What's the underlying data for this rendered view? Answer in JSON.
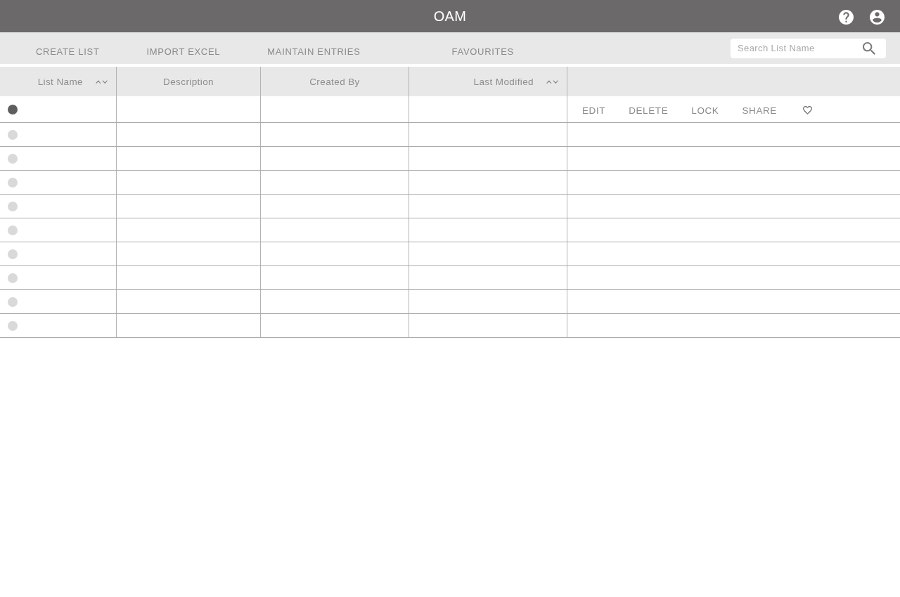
{
  "app_bar": {
    "title": "OAM"
  },
  "toolbar": {
    "buttons": [
      "CREATE LIST",
      "IMPORT EXCEL",
      "MAINTAIN ENTRIES",
      "FAVOURITES"
    ],
    "search": {
      "placeholder": "Search List Name"
    }
  },
  "table": {
    "columns": [
      {
        "label": "List Name",
        "sortable": true
      },
      {
        "label": "Description",
        "sortable": false
      },
      {
        "label": "Created By",
        "sortable": false
      },
      {
        "label": "Last Modified",
        "sortable": true
      }
    ],
    "rows": [
      {
        "selected": true
      },
      {
        "selected": false
      },
      {
        "selected": false
      },
      {
        "selected": false
      },
      {
        "selected": false
      },
      {
        "selected": false
      },
      {
        "selected": false
      },
      {
        "selected": false
      },
      {
        "selected": false
      },
      {
        "selected": false
      }
    ],
    "row_actions": {
      "buttons": [
        "EDIT",
        "DELETE",
        "LOCK",
        "SHARE"
      ],
      "favourite": false
    }
  }
}
